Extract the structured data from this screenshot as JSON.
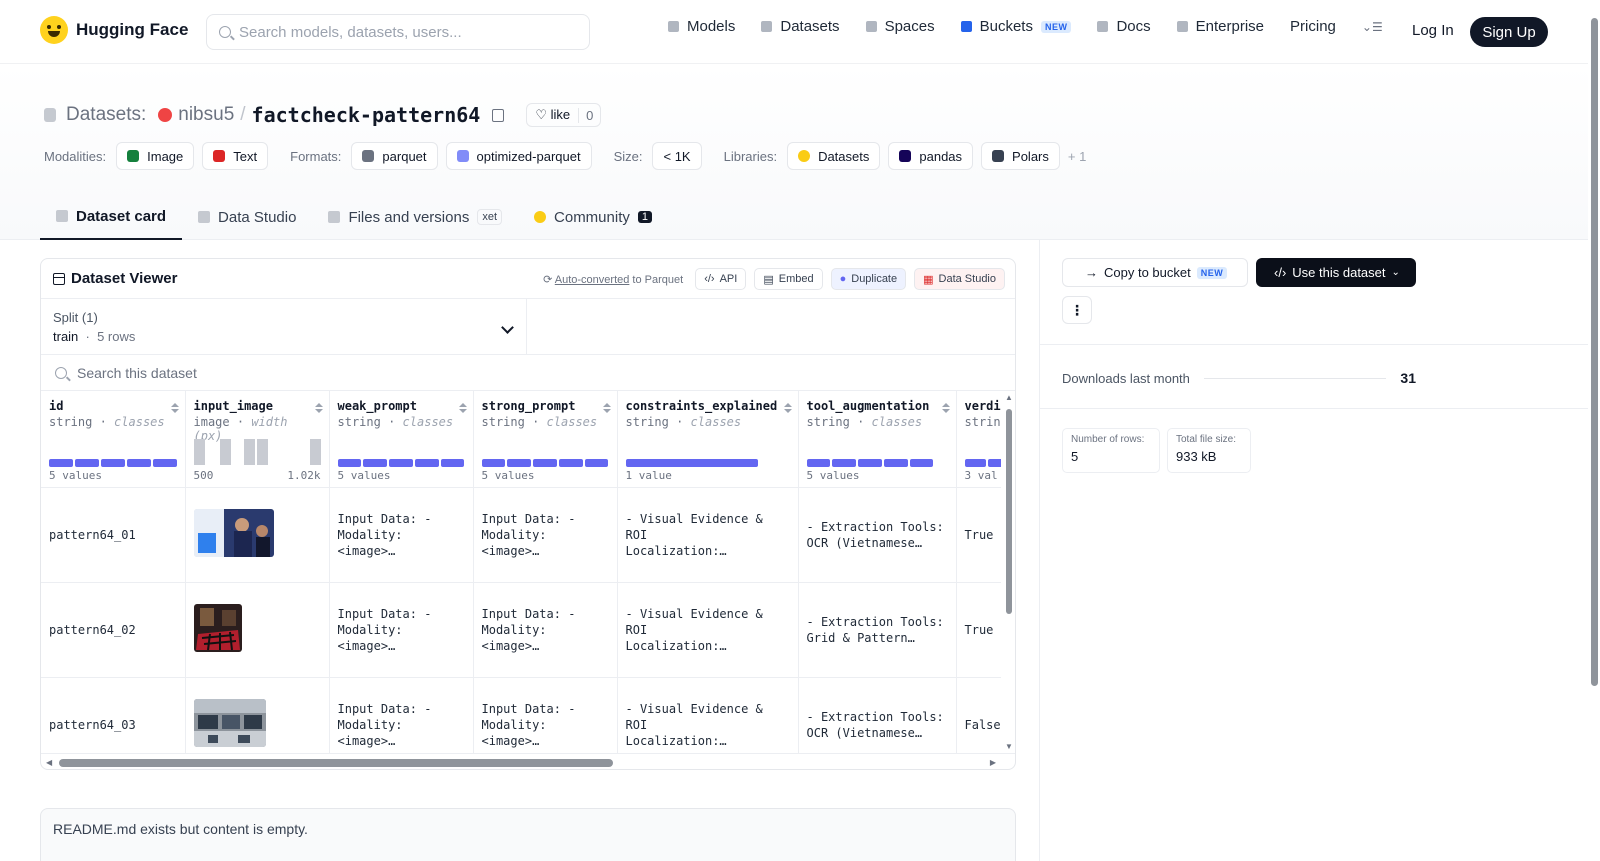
{
  "header": {
    "logo_text": "Hugging Face",
    "search_placeholder": "Search models, datasets, users...",
    "nav": [
      {
        "label": "Models",
        "icon": "cube-icon"
      },
      {
        "label": "Datasets",
        "icon": "database-icon"
      },
      {
        "label": "Spaces",
        "icon": "grid-icon"
      },
      {
        "label": "Buckets",
        "icon": "bucket-icon",
        "badge": "NEW"
      },
      {
        "label": "Docs",
        "icon": "book-icon"
      },
      {
        "label": "Enterprise",
        "icon": "enterprise-icon"
      },
      {
        "label": "Pricing"
      }
    ],
    "login": "Log In",
    "signup": "Sign Up"
  },
  "repo": {
    "section": "Datasets:",
    "owner": "nibsu5",
    "name": "factcheck-pattern64",
    "like_label": "like",
    "like_count": "0"
  },
  "meta": {
    "modalities_label": "Modalities:",
    "modalities": [
      "Image",
      "Text"
    ],
    "formats_label": "Formats:",
    "formats": [
      "parquet",
      "optimized-parquet"
    ],
    "size_label": "Size:",
    "size": "< 1K",
    "libraries_label": "Libraries:",
    "libraries": [
      "Datasets",
      "pandas",
      "Polars"
    ],
    "more": "+ 1"
  },
  "tabs": [
    {
      "label": "Dataset card",
      "active": true
    },
    {
      "label": "Data Studio"
    },
    {
      "label": "Files and versions",
      "badge": "xet"
    },
    {
      "label": "Community",
      "badge": "1"
    }
  ],
  "viewer": {
    "title": "Dataset Viewer",
    "auto_link": "Auto-converted",
    "auto_rest": " to Parquet",
    "buttons": [
      "API",
      "Embed",
      "Duplicate",
      "Data Studio"
    ],
    "split_label": "Split (1)",
    "split_value": "train",
    "split_rows": "5 rows",
    "search_placeholder": "Search this dataset",
    "columns": [
      {
        "name": "id",
        "type": "string",
        "kind": "classes",
        "foot_left": "5 values",
        "foot_right": ""
      },
      {
        "name": "input_image",
        "type": "image",
        "kind": "width (px)",
        "foot_left": "500",
        "foot_right": "1.02k"
      },
      {
        "name": "weak_prompt",
        "type": "string",
        "kind": "classes",
        "foot_left": "5 values",
        "foot_right": ""
      },
      {
        "name": "strong_prompt",
        "type": "string",
        "kind": "classes",
        "foot_left": "5 values",
        "foot_right": ""
      },
      {
        "name": "constraints_explained",
        "type": "string",
        "kind": "classes",
        "foot_left": "1 value",
        "foot_right": ""
      },
      {
        "name": "tool_augmentation",
        "type": "string",
        "kind": "classes",
        "foot_left": "5 values",
        "foot_right": ""
      },
      {
        "name": "verdi",
        "type": "strin",
        "kind": "",
        "foot_left": "3 val",
        "foot_right": ""
      }
    ],
    "rows": [
      {
        "id": "pattern64_01",
        "weak": "Input Data: -\nModality: <image>…",
        "strong": "Input Data: -\nModality: <image>…",
        "constraints": "- Visual Evidence & ROI\nLocalization:…",
        "tool": "- Extraction Tools:\nOCR (Vietnamese…",
        "verdict": "True"
      },
      {
        "id": "pattern64_02",
        "weak": "Input Data: -\nModality: <image>…",
        "strong": "Input Data: -\nModality: <image>…",
        "constraints": "- Visual Evidence & ROI\nLocalization:…",
        "tool": "- Extraction Tools:\nGrid & Pattern…",
        "verdict": "True"
      },
      {
        "id": "pattern64_03",
        "weak": "Input Data: -\nModality: <image>…",
        "strong": "Input Data: -\nModality: <image>…",
        "constraints": "- Visual Evidence & ROI\nLocalization:…",
        "tool": "- Extraction Tools:\nOCR (Vietnamese…",
        "verdict": "False"
      }
    ]
  },
  "readme": "README.md exists but content is empty.",
  "sidebar": {
    "copy_bucket": "Copy to bucket",
    "copy_badge": "NEW",
    "use_dataset": "Use this dataset",
    "downloads_label": "Downloads last month",
    "downloads_value": "31",
    "rows_label": "Number of rows:",
    "rows_value": "5",
    "filesize_label": "Total file size:",
    "filesize_value": "933 kB"
  },
  "colors": {
    "accent_bar": "#6366f1",
    "signup_bg": "#111827",
    "owner_dot": "#ef4444"
  }
}
